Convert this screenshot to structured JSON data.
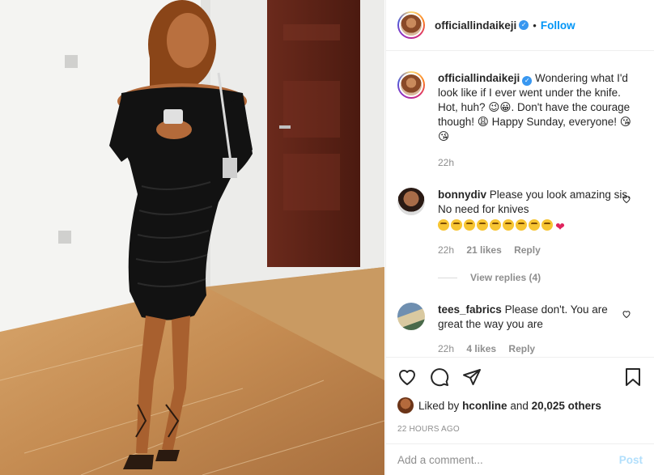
{
  "post": {
    "author": "officiallindaikeji",
    "separator": "•",
    "follow_label": "Follow",
    "caption": "Wondering what I'd look like if I ever went under the knife. Hot, huh? 😉😀. Don't have the courage though! 😩 Happy Sunday, everyone! 😘😘",
    "caption_time": "22h"
  },
  "comments": [
    {
      "user": "bonnydiv",
      "text": "Please you look amazing sis. No need for knives",
      "emoji_line": "😘😘😘🙌🙌🤗🤗🤗🤗❤",
      "time": "22h",
      "likes": "21 likes",
      "reply_label": "Reply",
      "view_replies": "View replies (4)"
    },
    {
      "user": "tees_fabrics",
      "text": "Please don't. You are great the way you are",
      "time": "22h",
      "likes": "4 likes",
      "reply_label": "Reply"
    }
  ],
  "actions": {
    "icons": [
      "heart-icon",
      "comment-icon",
      "share-icon",
      "bookmark-icon"
    ],
    "liked_by_prefix": "Liked by",
    "liked_by_user": "hconline",
    "liked_by_and": "and",
    "liked_by_count": "20,025 others",
    "post_time": "22 HOURS AGO"
  },
  "add_comment": {
    "placeholder": "Add a comment...",
    "post_label": "Post"
  },
  "colors": {
    "accent": "#0095f6",
    "verified": "#3897f0",
    "muted": "#8e8e8e",
    "post_disabled": "#b2dffc"
  }
}
